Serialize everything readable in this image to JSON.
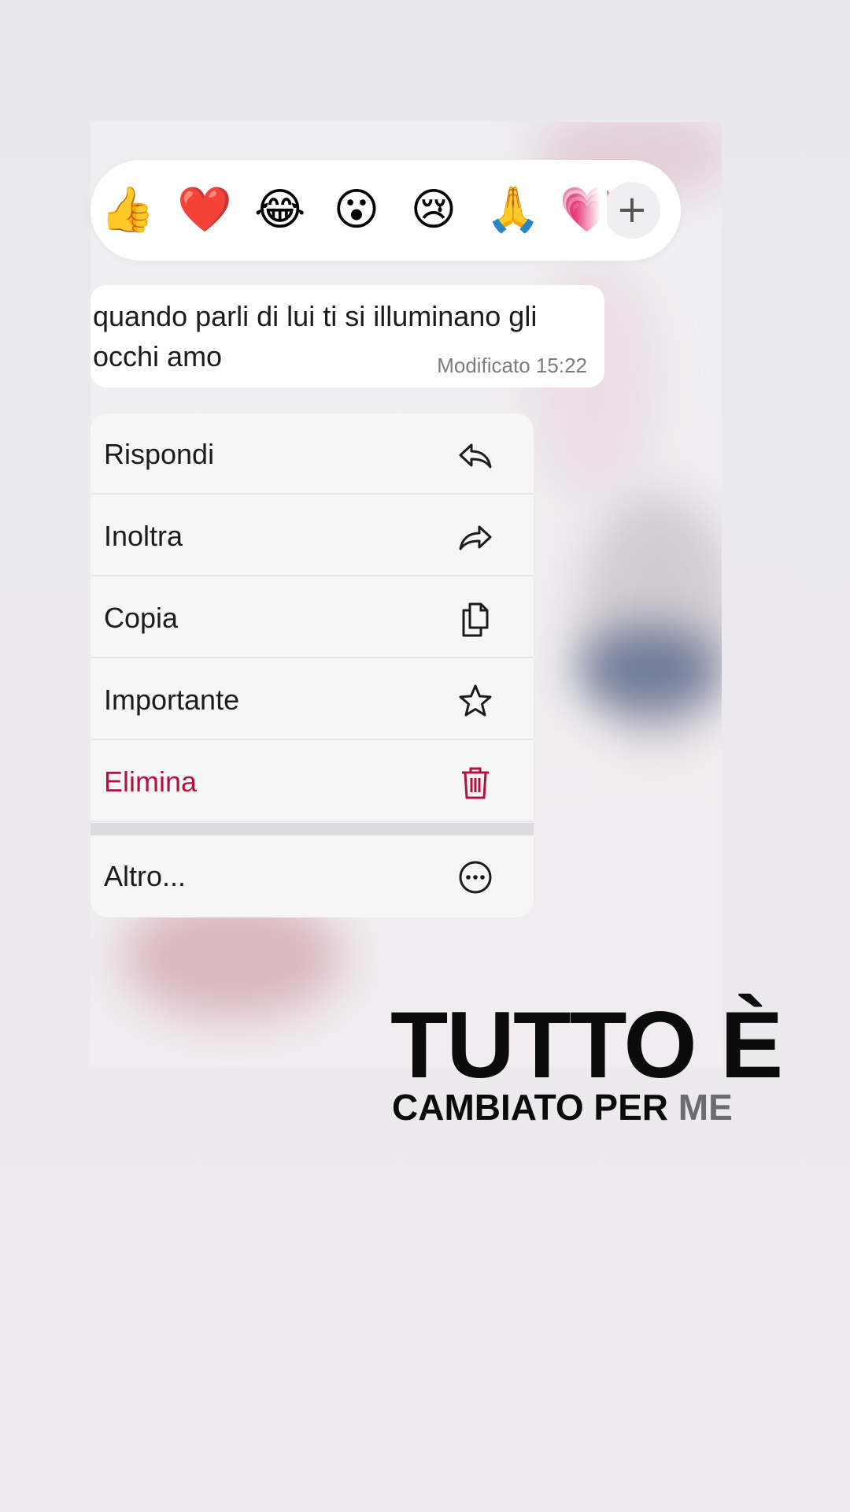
{
  "reactions": {
    "emojis": [
      {
        "name": "thumbs-up",
        "glyph": "👍"
      },
      {
        "name": "red-heart",
        "glyph": "❤️"
      },
      {
        "name": "tears-of-joy",
        "glyph": "😂"
      },
      {
        "name": "surprised",
        "glyph": "😮"
      },
      {
        "name": "crying",
        "glyph": "😢"
      },
      {
        "name": "folded-hands",
        "glyph": "🙏"
      },
      {
        "name": "heart-partial",
        "glyph": "💗"
      }
    ],
    "plus_label": "+"
  },
  "message": {
    "text": "quando parli di lui ti si illuminano gli occhi amo",
    "meta": "Modificato 15:22"
  },
  "menu": {
    "items": [
      {
        "label": "Rispondi",
        "icon": "reply-icon"
      },
      {
        "label": "Inoltra",
        "icon": "forward-icon"
      },
      {
        "label": "Copia",
        "icon": "copy-icon"
      },
      {
        "label": "Importante",
        "icon": "star-icon"
      },
      {
        "label": "Elimina",
        "icon": "trash-icon"
      },
      {
        "label": "Altro...",
        "icon": "more-icon"
      }
    ]
  },
  "caption": {
    "line1": "TUTTO È",
    "line2_main": "CAMBIATO PER ",
    "line2_faded": "ME"
  },
  "colors": {
    "danger": "#b1123f",
    "text": "#1c1c1e",
    "meta": "#7b7b80"
  }
}
